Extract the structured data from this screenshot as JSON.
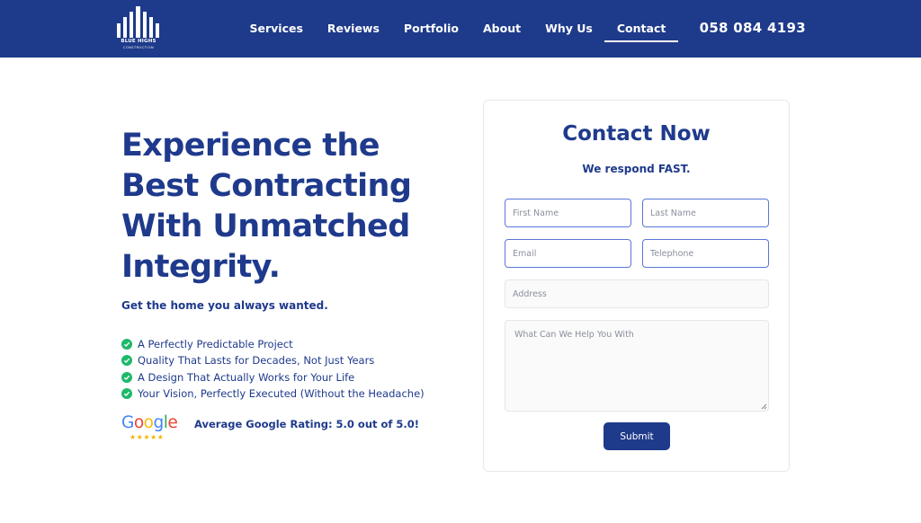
{
  "brand": {
    "name": "BLUE HIGHS",
    "tagline": "CONSTRUCTION",
    "icon": "building-bars-logo"
  },
  "nav": {
    "items": [
      {
        "label": "Services"
      },
      {
        "label": "Reviews"
      },
      {
        "label": "Portfolio"
      },
      {
        "label": "About"
      },
      {
        "label": "Why Us"
      },
      {
        "label": "Contact"
      }
    ],
    "active": "Contact",
    "phone": "058 084 4193"
  },
  "hero": {
    "title": "Experience the Best Contracting With Unmatched Integrity.",
    "subtitle": "Get the home you always wanted.",
    "benefits": [
      "A Perfectly Predictable Project",
      "Quality That Lasts for Decades, Not Just Years",
      "A Design That Actually Works for Your Life",
      "Your Vision, Perfectly Executed (Without the Headache)"
    ],
    "rating_text": "Average Google Rating: 5.0 out of 5.0!",
    "rating_stars": 5
  },
  "form": {
    "title": "Contact Now",
    "subtitle": "We respond FAST.",
    "first_name_placeholder": "First Name",
    "last_name_placeholder": "Last Name",
    "email_placeholder": "Email",
    "telephone_placeholder": "Telephone",
    "address_placeholder": "Address",
    "message_placeholder": "What Can We Help You With",
    "submit_label": "Submit"
  },
  "colors": {
    "primary": "#1e3a8a",
    "heading": "#1f3a8c",
    "check": "#1fb86b",
    "star": "#f4b400"
  }
}
